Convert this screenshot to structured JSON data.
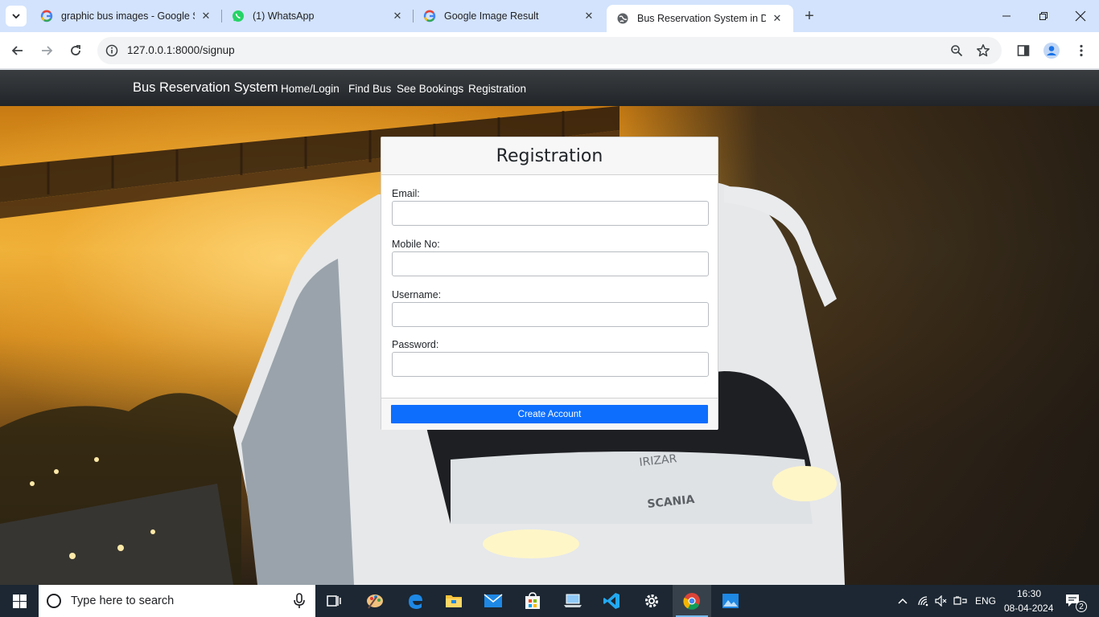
{
  "browser": {
    "tabs": [
      {
        "title": "graphic bus images - Google Se",
        "favicon": "google-g-icon",
        "active": false
      },
      {
        "title": "(1) WhatsApp",
        "favicon": "whatsapp-icon",
        "active": false
      },
      {
        "title": "Google Image Result",
        "favicon": "google-g-icon",
        "active": false
      },
      {
        "title": "Bus Reservation System in Djan",
        "favicon": "globe-icon",
        "active": true
      }
    ],
    "url": "127.0.0.1:8000/signup"
  },
  "site": {
    "brand": "Bus Reservation System",
    "nav": [
      "Home/Login",
      "Find Bus",
      "See Bookings",
      "Registration"
    ]
  },
  "form": {
    "title": "Registration",
    "fields": [
      {
        "label": "Email:",
        "value": ""
      },
      {
        "label": "Mobile No:",
        "value": ""
      },
      {
        "label": "Username:",
        "value": ""
      },
      {
        "label": "Password:",
        "value": ""
      }
    ],
    "submit": "Create Account"
  },
  "taskbar": {
    "search_placeholder": "Type here to search",
    "language": "ENG",
    "time": "16:30",
    "date": "08-04-2024",
    "notification_count": "2"
  },
  "colors": {
    "primary_button": "#0d6efd",
    "navbar": "#212529",
    "tabstrip": "#d3e3fd",
    "taskbar": "#1c2733"
  }
}
